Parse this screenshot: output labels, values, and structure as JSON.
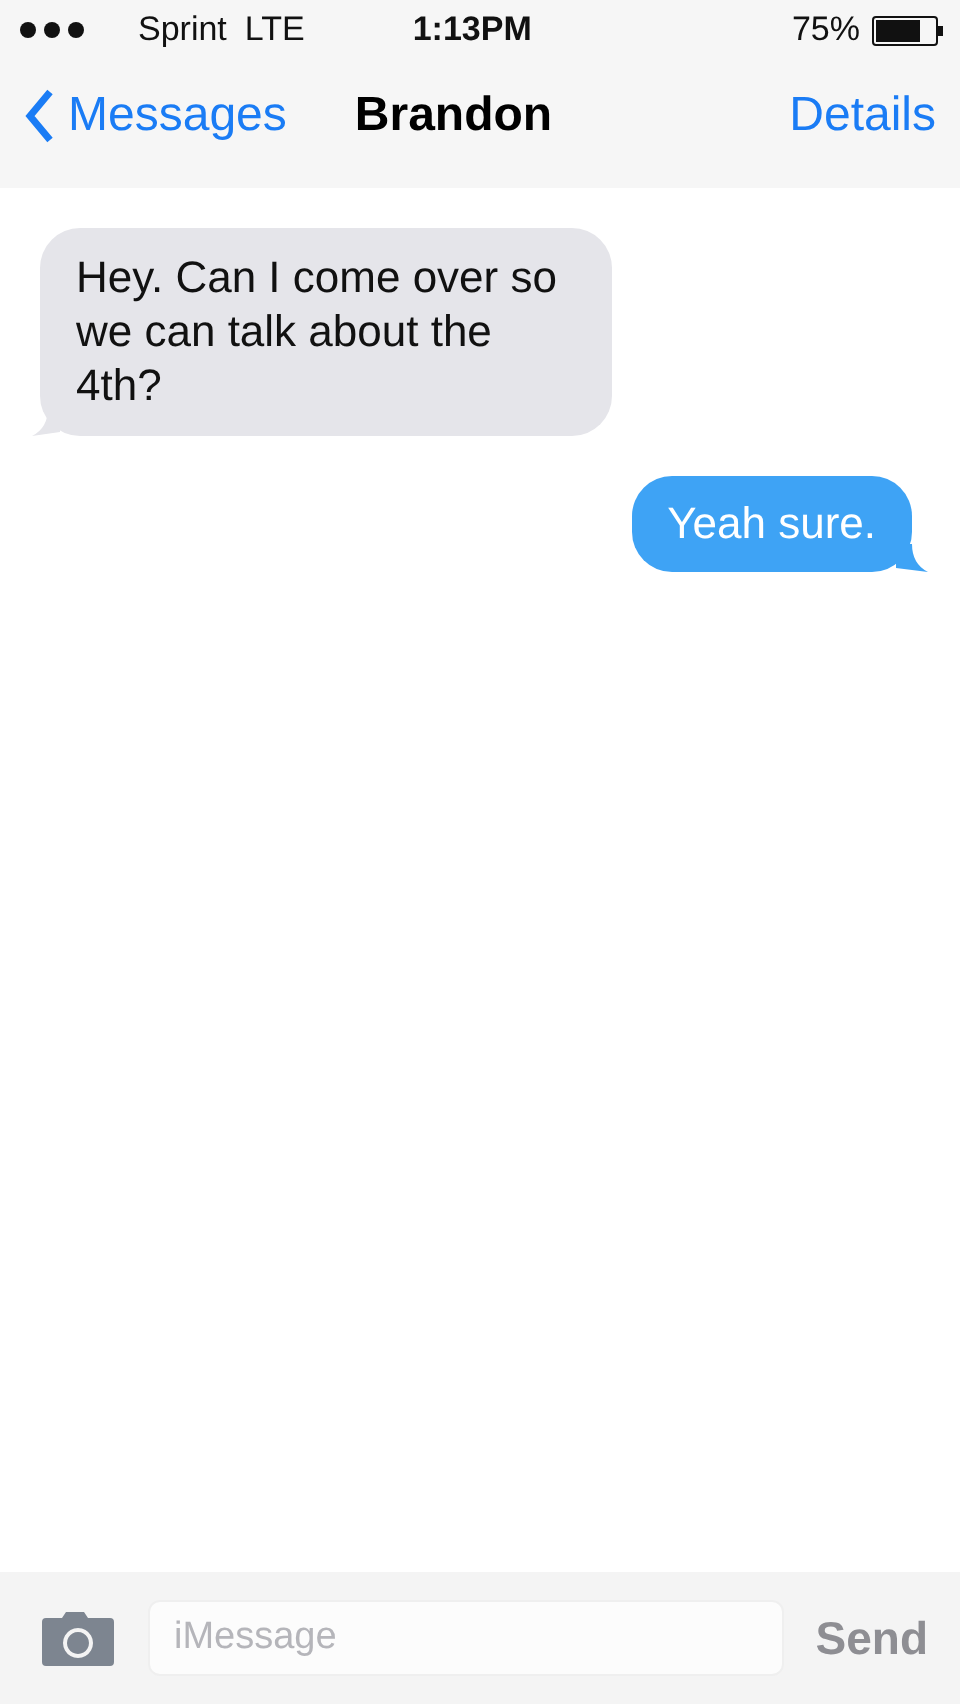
{
  "status_bar": {
    "carrier": "Sprint",
    "network": "LTE",
    "time": "1:13PM",
    "battery": "75%"
  },
  "nav": {
    "back": "Messages",
    "title": "Brandon",
    "action": "Details"
  },
  "messages": [
    {
      "kind": "received",
      "text": "Hey. Can I come over so we can talk about the 4th?"
    },
    {
      "kind": "sent",
      "text": "Yeah sure."
    }
  ],
  "composer": {
    "placeholder": "iMessage",
    "send": "Send"
  }
}
